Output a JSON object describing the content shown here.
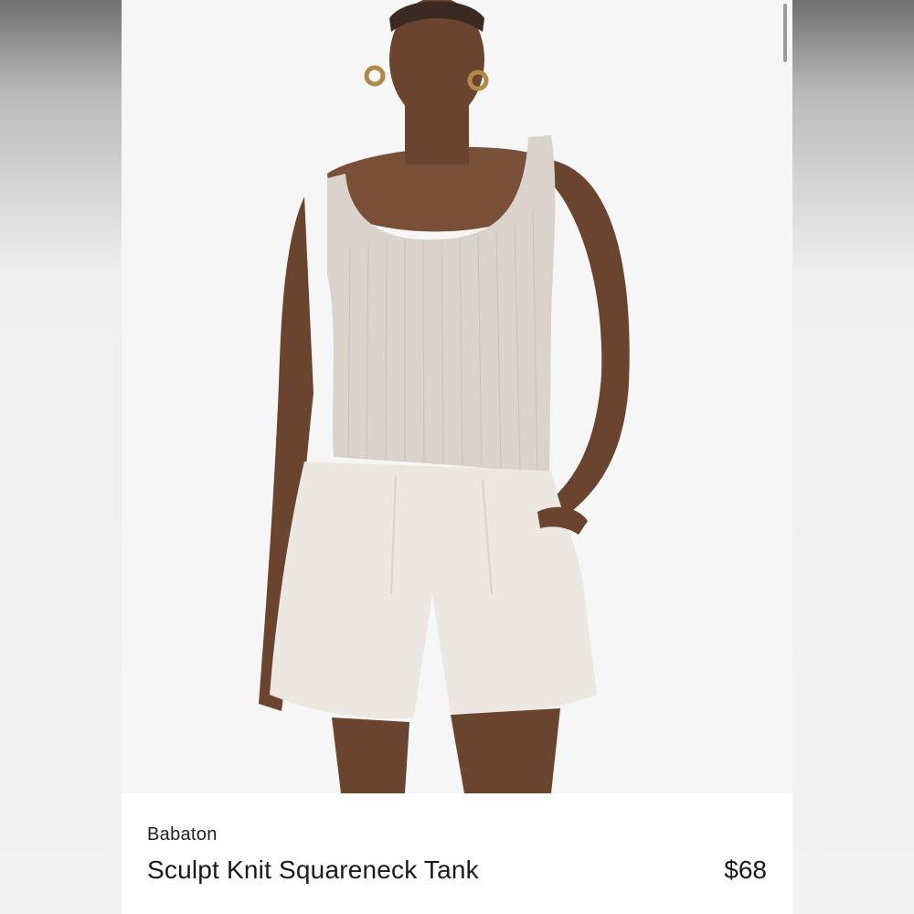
{
  "product": {
    "brand": "Babaton",
    "title": "Sculpt Knit Squareneck Tank",
    "price": "$68",
    "image": {
      "alt": "Model wearing beige ribbed square-neck tank top and cream pleated shorts"
    }
  },
  "colors": {
    "tank": "#d9d3cb",
    "shorts": "#ece8e1",
    "skin": "#6b4430",
    "background": "#f6f6f6"
  }
}
